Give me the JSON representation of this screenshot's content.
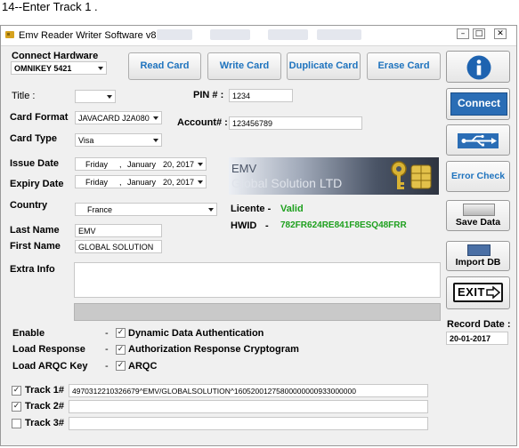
{
  "caption": "14--Enter Track 1 .",
  "window": {
    "title": "Emv Reader Writer Software v8.6"
  },
  "hardware": {
    "label": "Connect Hardware",
    "device": "OMNIKEY 5421"
  },
  "toolbar": {
    "read_card": "Read Card",
    "write_card": "Write Card",
    "duplicate_card": "Duplicate Card",
    "erase_card": "Erase Card"
  },
  "form": {
    "title_label": "Title :",
    "title_value": "",
    "pin_label": "PIN # :",
    "pin_value": "1234",
    "card_format_label": "Card Format",
    "card_format_value": "JAVACARD J2A080",
    "account_label": "Account# :",
    "account_value": "123456789",
    "card_type_label": "Card Type",
    "card_type_value": "Visa",
    "issue_date_label": "Issue Date",
    "issue_date": {
      "day": "Friday",
      "month": "January",
      "date": "20, 2017"
    },
    "expiry_date_label": "Expiry Date",
    "expiry_date": {
      "day": "Friday",
      "month": "January",
      "date": "20, 2017"
    },
    "country_label": "Country",
    "country_value": "France",
    "last_name_label": "Last Name",
    "last_name_value": "EMV",
    "first_name_label": "First Name",
    "first_name_value": "GLOBAL SOLUTION",
    "extra_info_label": "Extra Info",
    "extra_info_value": "",
    "separator": "-"
  },
  "license": {
    "label": "Licente -",
    "value": "Valid",
    "hwid_label": "HWID",
    "hwid_dash": "-",
    "hwid_value": "782FR624RE841F8ESQ48FRR"
  },
  "banner": {
    "line1": "EMV",
    "line2": "Global Solution LTD"
  },
  "options": [
    {
      "label": "Enable",
      "text": "Dynamic Data Authentication",
      "checked": true
    },
    {
      "label": "Load Response",
      "text": "Authorization Response Cryptogram",
      "checked": true
    },
    {
      "label": "Load ARQC Key",
      "text": "ARQC",
      "checked": true
    }
  ],
  "tracks": [
    {
      "label": "Track 1#",
      "checked": true,
      "value": "4970312210326679^EMV/GLOBALSOLUTION^16052001275800000000933000000"
    },
    {
      "label": "Track 2#",
      "checked": true,
      "value": ""
    },
    {
      "label": "Track 3#",
      "checked": false,
      "value": ""
    }
  ],
  "side": {
    "connect": "Connect",
    "error_check": "Error Check",
    "save_data": "Save Data",
    "import_db": "Import DB",
    "exit": "EXIT"
  },
  "record_date": {
    "label": "Record Date :",
    "value": "20-01-2017"
  },
  "colors": {
    "accent": "#1e73be",
    "valid_green": "#1ea01e",
    "connect_bg": "#2a6db5"
  }
}
